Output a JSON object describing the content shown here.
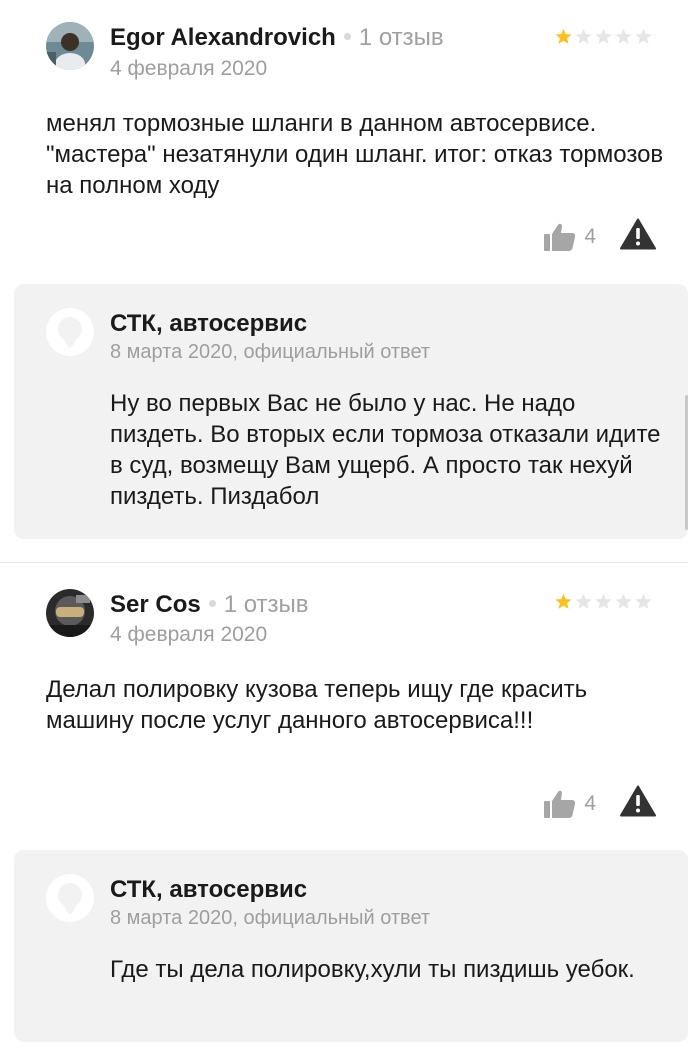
{
  "reviews": [
    {
      "author": "Egor Alexandrovich",
      "review_count": "1 отзыв",
      "date": "4 февраля 2020",
      "rating": 1,
      "text": "менял тормозные шланги в данном автосервисе. \"мастера\" незатянули один шланг. итог: отказ тормозов на полном ходу",
      "likes": "4",
      "reply": {
        "org": "СТК, автосервис",
        "meta": "8 марта 2020, официальный ответ",
        "text": "Ну во первых Вас не было у нас. Не надо пиздеть. Во вторых если тормоза отказали идите в суд, возмещу Вам ущерб. А просто так нехуй пиздеть. Пиздабол"
      }
    },
    {
      "author": "Ser Cos",
      "review_count": "1 отзыв",
      "date": "4 февраля 2020",
      "rating": 1,
      "text": "Делал полировку кузова теперь ищу где красить машину после услуг данного автосервиса!!!",
      "likes": "4",
      "reply": {
        "org": "СТК, автосервис",
        "meta": "8 марта 2020, официальный ответ",
        "text": "Где ты дела полировку,хули ты пиздишь уебок."
      }
    }
  ],
  "colors": {
    "star_filled": "#fcc21b",
    "star_empty": "#e5e5e5",
    "reply_bg": "#f2f2f2",
    "icon_gray": "#a6a6a6",
    "warning_dark": "#333333"
  },
  "icons": {
    "like": "thumbs-up-icon",
    "report": "warning-triangle-icon",
    "org_logo": "org-logo-icon"
  }
}
